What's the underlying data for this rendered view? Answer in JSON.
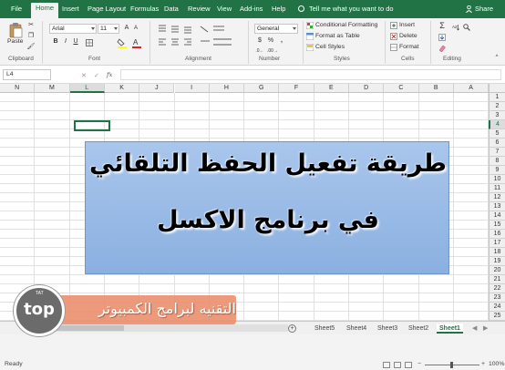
{
  "ribbon_tabs": [
    "File",
    "Home",
    "Insert",
    "Page Layout",
    "Formulas",
    "Data",
    "Review",
    "View",
    "Add-ins",
    "Help"
  ],
  "active_tab": "Home",
  "tell_me": "Tell me what you want to do",
  "share": "Share",
  "clipboard": {
    "paste": "Paste",
    "label": "Clipboard"
  },
  "font": {
    "name": "Arial",
    "size": "11",
    "label": "Font",
    "bold": "B",
    "italic": "I",
    "underline": "U"
  },
  "alignment": {
    "label": "Alignment"
  },
  "number": {
    "format": "General",
    "label": "Number",
    "currency": "$",
    "percent": "%",
    "comma": ","
  },
  "styles": {
    "conditional": "Conditional Formatting",
    "as_table": "Format as Table",
    "cell_styles": "Cell Styles",
    "label": "Styles"
  },
  "cells": {
    "insert": "Insert",
    "delete": "Delete",
    "format": "Format",
    "label": "Cells"
  },
  "editing": {
    "label": "Editing",
    "sigma": "Σ"
  },
  "formula_bar": {
    "name_box": "L4",
    "fx": "fx",
    "value": ""
  },
  "columns": [
    "N",
    "M",
    "L",
    "K",
    "J",
    "I",
    "H",
    "G",
    "F",
    "E",
    "D",
    "C",
    "B",
    "A"
  ],
  "selected_column": "L",
  "rows": [
    "1",
    "2",
    "3",
    "4",
    "5",
    "6",
    "7",
    "8",
    "9",
    "10",
    "11",
    "12",
    "13",
    "14",
    "15",
    "16",
    "17",
    "18",
    "19",
    "20",
    "21",
    "22",
    "23",
    "24",
    "25",
    "26",
    "27",
    "28"
  ],
  "selected_row": "4",
  "overlay": {
    "line1": "طريقة تفعيل الحفظ التلقائي",
    "line2": "في برنامج الاكسل"
  },
  "sheets": [
    "Sheet5",
    "Sheet4",
    "Sheet3",
    "Sheet2",
    "Sheet1"
  ],
  "active_sheet": "Sheet1",
  "status": {
    "ready": "Ready",
    "zoom": "100%"
  },
  "watermark": {
    "logo": "top",
    "small": "TAT",
    "text": "التقنيه لبرامج الكمبيوتر"
  },
  "colors": {
    "excel_green": "#217346",
    "overlay_blue": "#9dbde9",
    "watermark_orange": "#e98c69"
  }
}
